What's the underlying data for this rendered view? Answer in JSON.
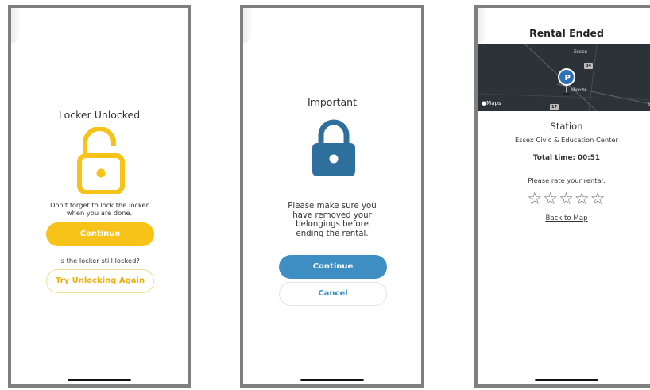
{
  "screens": [
    {
      "title": "Locker Unlocked",
      "message": "Don't forget to lock the locker\nwhen you are done.",
      "continue_label": "Continue",
      "question": "Is the locker still locked?",
      "retry_label": "Try Unlocking Again",
      "icon": "lock-open-icon",
      "accent": "#f7c318"
    },
    {
      "title": "Important",
      "message": "Please make sure you\nhave removed your\nbelongings before\nending the rental.",
      "continue_label": "Continue",
      "cancel_label": "Cancel",
      "icon": "lock-closed-icon",
      "accent": "#2f6f9e"
    },
    {
      "title": "Rental Ended",
      "map": {
        "city_label": "Essex",
        "maps_label": "Maps",
        "shield_1": "34",
        "shield_2": "17",
        "edge_label": "Lo",
        "road_label": "Main St"
      },
      "station_label": "Station",
      "station_name": "Essex Civic & Education Center",
      "total_time": "Total time: 00:51",
      "rate_prompt": "Please rate your rental:",
      "rating_stars": 5,
      "rating_value": 0,
      "back_label": "Back to Map"
    }
  ]
}
